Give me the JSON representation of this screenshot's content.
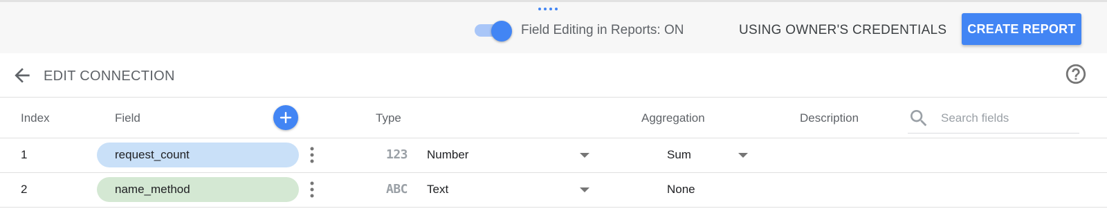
{
  "topbar": {
    "toggle_label": "Field Editing in Reports: ON",
    "toggle_state": "on",
    "credentials_label": "USING OWNER'S CREDENTIALS",
    "create_report_label": "CREATE REPORT"
  },
  "header": {
    "title": "EDIT CONNECTION",
    "back_icon": "arrow-back-icon",
    "help_icon": "help-circle-icon"
  },
  "columns": {
    "index": "Index",
    "field": "Field",
    "type": "Type",
    "aggregation": "Aggregation",
    "description": "Description"
  },
  "search": {
    "placeholder": "Search fields",
    "value": ""
  },
  "rows": [
    {
      "index": "1",
      "field": "request_count",
      "type_icon": "123",
      "type": "Number",
      "aggregation": "Sum",
      "aggregation_editable": true,
      "color": "#c9e0f8"
    },
    {
      "index": "2",
      "field": "name_method",
      "type_icon": "ABC",
      "type": "Text",
      "aggregation": "None",
      "aggregation_editable": false,
      "color": "#d4e8d3"
    }
  ],
  "colors": {
    "accent": "#4285f4",
    "toggle_track": "#a9c6f8",
    "topbar_bg": "#f7f7f7",
    "metric_pill": "#c9e0f8",
    "dimension_pill": "#d4e8d3"
  }
}
